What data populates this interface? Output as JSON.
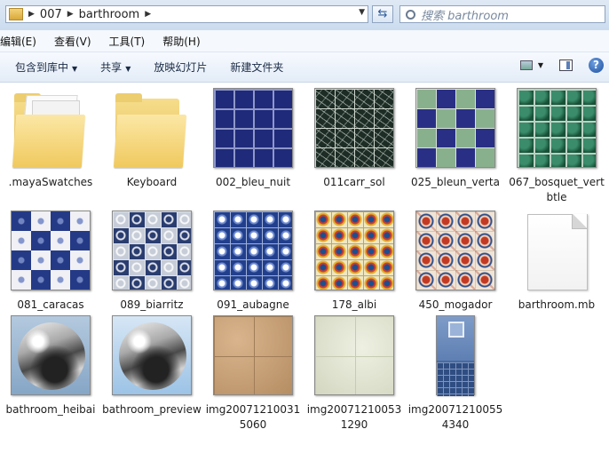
{
  "address": {
    "segments": [
      "007",
      "barthroom"
    ]
  },
  "search": {
    "placeholder": "搜索 barthroom"
  },
  "menu": [
    "编辑(E)",
    "查看(V)",
    "工具(T)",
    "帮助(H)"
  ],
  "commands": [
    {
      "label": "包含到库中",
      "dropdown": true
    },
    {
      "label": "共享",
      "dropdown": true
    },
    {
      "label": "放映幻灯片",
      "dropdown": false
    },
    {
      "label": "新建文件夹",
      "dropdown": false
    }
  ],
  "files": [
    {
      "name": ".mayaSwatches",
      "kind": "folder",
      "icon": "folder-icon"
    },
    {
      "name": "Keyboard",
      "kind": "folder",
      "icon": "folder-icon"
    },
    {
      "name": "002_bleu_nuit",
      "kind": "texture"
    },
    {
      "name": "011carr_sol",
      "kind": "texture"
    },
    {
      "name": "025_bleun_verta",
      "kind": "texture"
    },
    {
      "name": "067_bosquet_vertbtle",
      "kind": "texture"
    },
    {
      "name": "081_caracas",
      "kind": "texture"
    },
    {
      "name": "089_biarritz",
      "kind": "texture"
    },
    {
      "name": "091_aubagne",
      "kind": "texture"
    },
    {
      "name": "178_albi",
      "kind": "texture"
    },
    {
      "name": "450_mogador",
      "kind": "texture"
    },
    {
      "name": "barthroom.mb",
      "kind": "file",
      "icon": "blank-file-icon"
    },
    {
      "name": "bathroom_heibai",
      "kind": "render"
    },
    {
      "name": "bathroom_preview",
      "kind": "render"
    },
    {
      "name": "img200712100315060",
      "kind": "texture"
    },
    {
      "name": "img200712100531290",
      "kind": "texture"
    },
    {
      "name": "img200712100554340",
      "kind": "texture"
    }
  ]
}
